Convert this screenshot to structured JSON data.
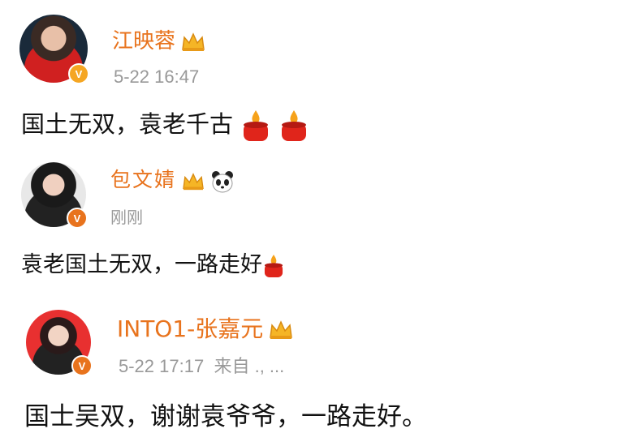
{
  "posts": [
    {
      "name": "江映蓉",
      "time": "5-22 16:47",
      "text": "国土无双，袁老千古",
      "badge": "V",
      "icons": [
        "crown-icon",
        "candle-icon",
        "candle-icon"
      ]
    },
    {
      "name": "包文婧",
      "time": "刚刚",
      "text": "袁老国土无双，一路走好",
      "badge": "V",
      "icons": [
        "crown-icon",
        "panda-icon",
        "candle-icon"
      ]
    },
    {
      "name": "INTO1-张嘉元",
      "time": "5-22 17:17",
      "source": "来自",
      "source_rest": "., ...",
      "text": "国士吴双，谢谢袁爷爷，一路走好。",
      "badge": "V",
      "icons": [
        "crown-icon"
      ]
    }
  ],
  "colors": {
    "name": "#e8731d",
    "meta": "#999999",
    "badge": "#f5a623",
    "candle": "#e0251b"
  }
}
